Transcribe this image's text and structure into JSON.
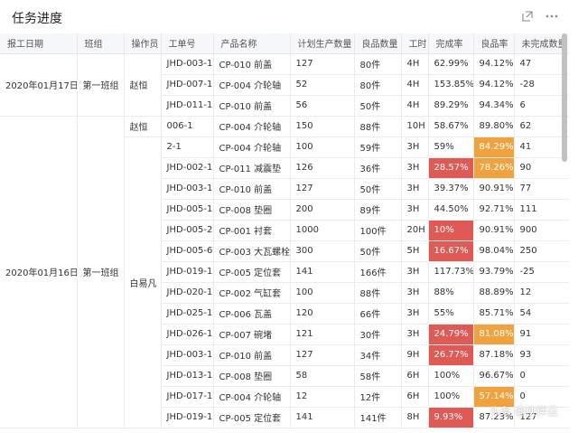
{
  "panel": {
    "title": "任务进度"
  },
  "icons": {
    "expand": "expand-icon",
    "more": "more-icon"
  },
  "columns": [
    "报工日期",
    "班组",
    "操作员",
    "工单号",
    "产品名称",
    "计划生产数量",
    "良品数量",
    "工时",
    "完成率",
    "良品率",
    "未完成数量"
  ],
  "dates": [
    "2020年01月17日",
    "2020年01月16日"
  ],
  "teams": [
    "第一班组",
    "第一班组"
  ],
  "operators": [
    "赵恒",
    "赵恒",
    "白易凡"
  ],
  "rows": [
    [
      "JHD-003-1",
      "CP-010 前盖",
      "127",
      "80件",
      "4H",
      "62.99%",
      "94.12%",
      "47"
    ],
    [
      "JHD-007-1",
      "CP-004 介轮轴",
      "52",
      "80件",
      "4H",
      "153.85%",
      "94.12%",
      "-28"
    ],
    [
      "JHD-011-1",
      "CP-010 前盖",
      "56",
      "50件",
      "4H",
      "89.29%",
      "94.34%",
      "6"
    ],
    [
      "006-1",
      "CP-004 介轮轴",
      "150",
      "88件",
      "10H",
      "58.67%",
      "89.80%",
      "62"
    ],
    [
      "2-1",
      "CP-004 介轮轴",
      "100",
      "59件",
      "3H",
      "59%",
      "84.29%",
      "41"
    ],
    [
      "JHD-002-1",
      "CP-011 减震垫",
      "126",
      "36件",
      "3H",
      "28.57%",
      "78.26%",
      "90"
    ],
    [
      "JHD-003-1",
      "CP-010 前盖",
      "127",
      "50件",
      "3H",
      "39.37%",
      "90.91%",
      "77"
    ],
    [
      "JHD-005-1",
      "CP-008 垫圈",
      "200",
      "89件",
      "3H",
      "44.50%",
      "92.71%",
      "111"
    ],
    [
      "JHD-005-2",
      "CP-001 衬套",
      "1000",
      "100件",
      "20H",
      "10%",
      "90.91%",
      "900"
    ],
    [
      "JHD-005-6",
      "CP-003 大瓦螺栓",
      "300",
      "50件",
      "5H",
      "16.67%",
      "98.04%",
      "250"
    ],
    [
      "JHD-019-1",
      "CP-005 定位套",
      "141",
      "166件",
      "3H",
      "117.73%",
      "93.79%",
      "-25"
    ],
    [
      "JHD-020-1",
      "CP-002 气缸套",
      "100",
      "88件",
      "3H",
      "88%",
      "88.89%",
      "12"
    ],
    [
      "JHD-025-1",
      "CP-006 瓦盖",
      "120",
      "66件",
      "3H",
      "55%",
      "85.71%",
      "54"
    ],
    [
      "JHD-026-1",
      "CP-007 碗堵",
      "121",
      "30件",
      "3H",
      "24.79%",
      "81.08%",
      "91"
    ],
    [
      "JHD-003-1",
      "CP-010 前盖",
      "127",
      "34件",
      "9H",
      "26.77%",
      "87.18%",
      "93"
    ],
    [
      "JHD-013-1",
      "CP-008 垫圈",
      "58",
      "58件",
      "6H",
      "100%",
      "96.67%",
      "0"
    ],
    [
      "JHD-017-1",
      "CP-004 介轮轴",
      "12",
      "12件",
      "6H",
      "100%",
      "57.14%",
      "0"
    ],
    [
      "JHD-019-1",
      "CP-005 定位套",
      "141",
      "141件",
      "8H",
      "9.93%",
      "87.23%",
      "127"
    ]
  ],
  "highlight_colors": {
    "red": "#e05a55",
    "orange": "#f0a23e"
  },
  "completion_highlight": [
    false,
    false,
    false,
    false,
    false,
    true,
    false,
    false,
    true,
    true,
    false,
    false,
    false,
    true,
    true,
    false,
    false,
    true
  ],
  "quality_highlight": [
    false,
    false,
    false,
    false,
    true,
    true,
    false,
    false,
    false,
    false,
    false,
    false,
    false,
    true,
    false,
    false,
    true,
    false
  ],
  "watermark": "头条 @伙伴云"
}
